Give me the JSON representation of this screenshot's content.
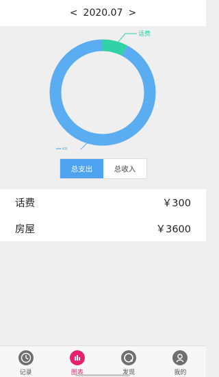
{
  "header": {
    "prev": "<",
    "month": "2020.07",
    "next": ">"
  },
  "chart": {
    "segments": [
      {
        "label": "话费",
        "value": 300,
        "color": "#30d2a6"
      },
      {
        "label": "房屋",
        "value": 3600,
        "color": "#5aadf0"
      }
    ]
  },
  "toggle": {
    "expense": "总支出",
    "income": "总收入"
  },
  "list": [
    {
      "name": "话费",
      "amount": "￥300"
    },
    {
      "name": "房屋",
      "amount": "￥3600"
    }
  ],
  "tabbar": {
    "record": "记录",
    "chart": "图表",
    "discover": "发现",
    "mine": "我的"
  }
}
